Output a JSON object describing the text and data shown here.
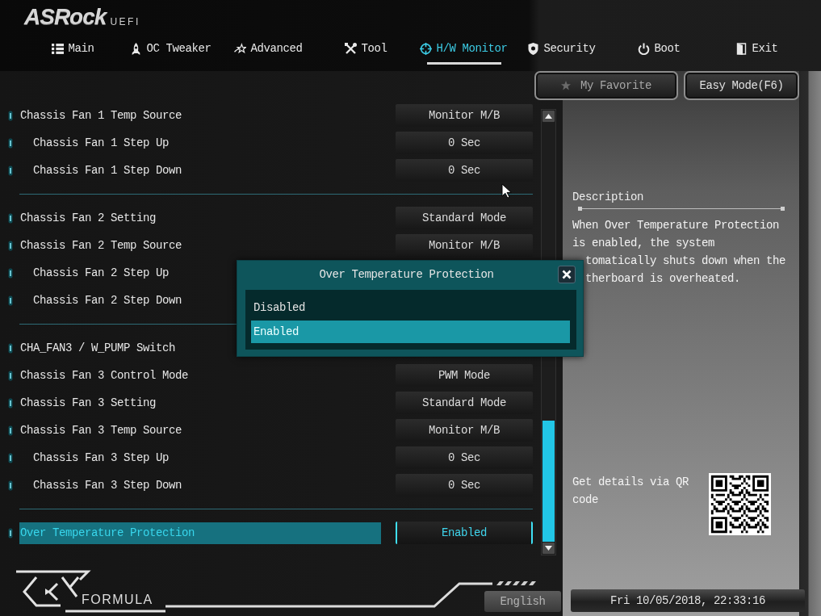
{
  "header": {
    "logo": "ASRock",
    "logo_suffix": "UEFI"
  },
  "tabs": [
    {
      "label": "Main",
      "selected": false
    },
    {
      "label": "OC Tweaker",
      "selected": false
    },
    {
      "label": "Advanced",
      "selected": false
    },
    {
      "label": "Tool",
      "selected": false
    },
    {
      "label": "H/W Monitor",
      "selected": true
    },
    {
      "label": "Security",
      "selected": false
    },
    {
      "label": "Boot",
      "selected": false
    },
    {
      "label": "Exit",
      "selected": false
    }
  ],
  "toolbar": {
    "buttons": [
      {
        "label": "My Favorite",
        "disabled": true
      },
      {
        "label": "Easy Mode(F6)",
        "disabled": false
      }
    ]
  },
  "settings": {
    "groups": [
      {
        "items": [
          {
            "label": "Chassis Fan 1 Temp Source",
            "value": "Monitor M/B",
            "selected": false,
            "children": [
              {
                "label": "Chassis Fan 1 Step Up",
                "value": "0 Sec",
                "selected": false
              },
              {
                "label": "Chassis Fan 1 Step Down",
                "value": "0 Sec",
                "selected": false
              }
            ]
          }
        ]
      },
      {
        "items": [
          {
            "label": "Chassis Fan 2 Setting",
            "value": "Standard Mode",
            "selected": false
          },
          {
            "label": "Chassis Fan 2 Temp Source",
            "value": "Monitor M/B",
            "selected": false,
            "children": [
              {
                "label": "Chassis Fan 2 Step Up",
                "selected": false
              },
              {
                "label": "Chassis Fan 2 Step Down",
                "selected": false
              }
            ]
          }
        ]
      },
      {
        "items": [
          {
            "label": "CHA_FAN3 / W_PUMP Switch",
            "selected": false
          },
          {
            "label": "Chassis Fan 3 Control Mode",
            "value": "PWM Mode",
            "selected": false
          },
          {
            "label": "Chassis Fan 3 Setting",
            "value": "Standard Mode",
            "selected": false
          },
          {
            "label": "Chassis Fan 3 Temp Source",
            "value": "Monitor M/B",
            "selected": false,
            "children": [
              {
                "label": "Chassis Fan 3 Step Up",
                "value": "0 Sec",
                "selected": false
              },
              {
                "label": "Chassis Fan 3 Step Down",
                "value": "0 Sec",
                "selected": false
              }
            ]
          }
        ]
      },
      {
        "items": [
          {
            "label": "Over Temperature Protection",
            "value": "Enabled",
            "selected": true
          }
        ]
      }
    ]
  },
  "popup": {
    "title": "Over Temperature Protection",
    "options": [
      {
        "label": "Disabled",
        "selected": false
      },
      {
        "label": "Enabled",
        "selected": true
      }
    ]
  },
  "description": {
    "heading": "Description",
    "lines": [
      {
        "text": "When Over Temperature Protection",
        "covered": false
      },
      {
        "text": "is enabled, the system",
        "covered": false
      },
      {
        "text": "tomatically shuts down when the",
        "covered": true
      },
      {
        "text": "therboard is overheated.",
        "covered": true
      }
    ]
  },
  "qr": {
    "caption": "Get details via QR code"
  },
  "footer": {
    "brand": "FORMULA",
    "language": "English",
    "datetime": "Fri 10/05/2018, 22:33:16"
  }
}
